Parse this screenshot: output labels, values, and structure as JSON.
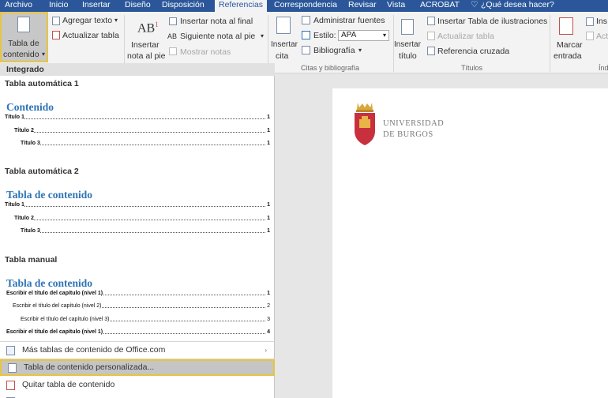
{
  "tabs": [
    "Archivo",
    "Inicio",
    "Insertar",
    "Diseño",
    "Disposición",
    "Referencias",
    "Correspondencia",
    "Revisar",
    "Vista",
    "ACROBAT",
    "¿Qué desea hacer?"
  ],
  "ribbon": {
    "toc_button": [
      "Tabla de",
      "contenido"
    ],
    "add_text": "Agregar texto",
    "update_table": "Actualizar tabla",
    "insert_footnote": [
      "Insertar",
      "nota al pie"
    ],
    "insert_endnote": "Insertar nota al final",
    "next_footnote": "Siguiente nota al pie",
    "show_notes": "Mostrar notas",
    "insert_citation": [
      "Insertar",
      "cita"
    ],
    "manage_sources": "Administrar fuentes",
    "style_label": "Estilo:",
    "style_value": "APA",
    "bibliography": "Bibliografía",
    "group_citations": "Citas y bibliografía",
    "insert_caption": [
      "Insertar",
      "título"
    ],
    "insert_table_figures": "Insertar Tabla de ilustraciones",
    "update_table2": "Actualizar tabla",
    "cross_reference": "Referencia cruzada",
    "group_titles": "Títulos",
    "mark_entry": [
      "Marcar",
      "entrada"
    ],
    "ins_cut": "Ins",
    "act_cut": "Act",
    "group_index_cut": "Índi"
  },
  "panel": {
    "header": "Integrado",
    "auto1": {
      "title": "Tabla automática 1",
      "heading": "Contenido",
      "lines": [
        {
          "t": "Título 1",
          "p": "1"
        },
        {
          "t": "Título 2",
          "p": "1"
        },
        {
          "t": "Título 3",
          "p": "1"
        }
      ]
    },
    "auto2": {
      "title": "Tabla automática 2",
      "heading": "Tabla de contenido",
      "lines": [
        {
          "t": "Título 1",
          "p": "1"
        },
        {
          "t": "Título 2",
          "p": "1"
        },
        {
          "t": "Título 3",
          "p": "1"
        }
      ]
    },
    "manual": {
      "title": "Tabla manual",
      "heading": "Tabla de contenido",
      "lines": [
        {
          "t": "Escribir el título del capítulo (nivel 1)",
          "p": "1"
        },
        {
          "t": "Escribir el título del capítulo (nivel 2)",
          "p": "2"
        },
        {
          "t": "Escribir el título del capítulo (nivel 3)",
          "p": "3"
        },
        {
          "t": "Escribir el título del capítulo (nivel 1)",
          "p": "4"
        }
      ]
    },
    "menu": {
      "more": "Más tablas de contenido de Office.com",
      "custom": "Tabla de contenido personalizada...",
      "remove": "Quitar tabla de contenido"
    }
  },
  "document": {
    "logo_line1": "UNIVERSIDAD",
    "logo_line2": "DE BURGOS"
  }
}
